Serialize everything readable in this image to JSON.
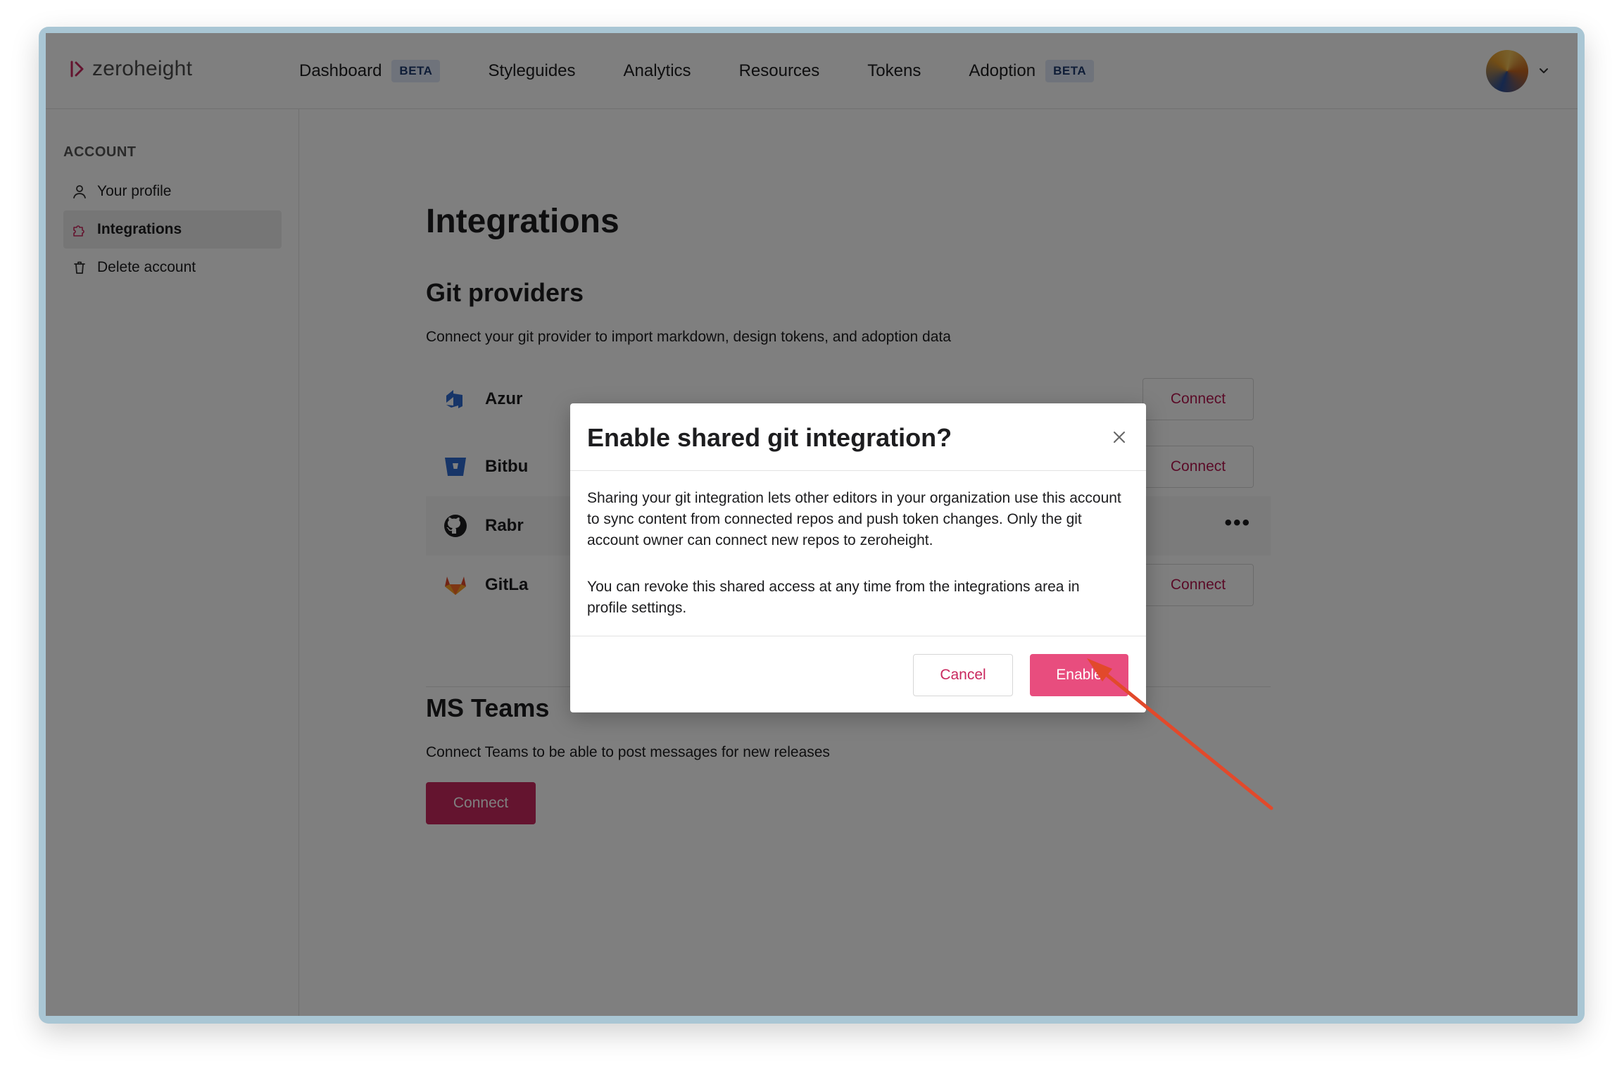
{
  "app": {
    "brand": "zeroheight"
  },
  "nav": {
    "items": [
      {
        "label": "Dashboard",
        "badge": "BETA"
      },
      {
        "label": "Styleguides",
        "badge": null
      },
      {
        "label": "Analytics",
        "badge": null
      },
      {
        "label": "Resources",
        "badge": null
      },
      {
        "label": "Tokens",
        "badge": null
      },
      {
        "label": "Adoption",
        "badge": "BETA"
      }
    ]
  },
  "sidebar": {
    "heading": "ACCOUNT",
    "items": [
      {
        "label": "Your profile",
        "icon": "user-icon",
        "active": false
      },
      {
        "label": "Integrations",
        "icon": "puzzle-icon",
        "active": true
      },
      {
        "label": "Delete account",
        "icon": "trash-icon",
        "active": false
      }
    ]
  },
  "main": {
    "title": "Integrations",
    "git": {
      "title": "Git providers",
      "description": "Connect your git provider to import markdown, design tokens, and adoption data",
      "providers": [
        {
          "name": "Azur",
          "icon": "azure-devops-icon",
          "action": "Connect"
        },
        {
          "name": "Bitbu",
          "icon": "bitbucket-icon",
          "action": "Connect"
        },
        {
          "name": "Rabr",
          "icon": "github-icon",
          "action": "•••"
        },
        {
          "name": "GitLa",
          "icon": "gitlab-icon",
          "action": "Connect"
        }
      ]
    },
    "teams": {
      "title": "MS Teams",
      "description": "Connect Teams to be able to post messages for new releases",
      "button": "Connect"
    }
  },
  "modal": {
    "title": "Enable shared git integration?",
    "body_1": "Sharing your git integration lets other editors in your organization use this account to sync content from connected repos and push token changes. Only the git account owner can connect new repos to zeroheight.",
    "body_2": "You can revoke this shared access at any time from the integrations area in profile settings.",
    "cancel": "Cancel",
    "confirm": "Enable"
  },
  "colors": {
    "accent": "#c9285e",
    "enable_button": "#e84d7e",
    "annotation": "#e2492b"
  }
}
